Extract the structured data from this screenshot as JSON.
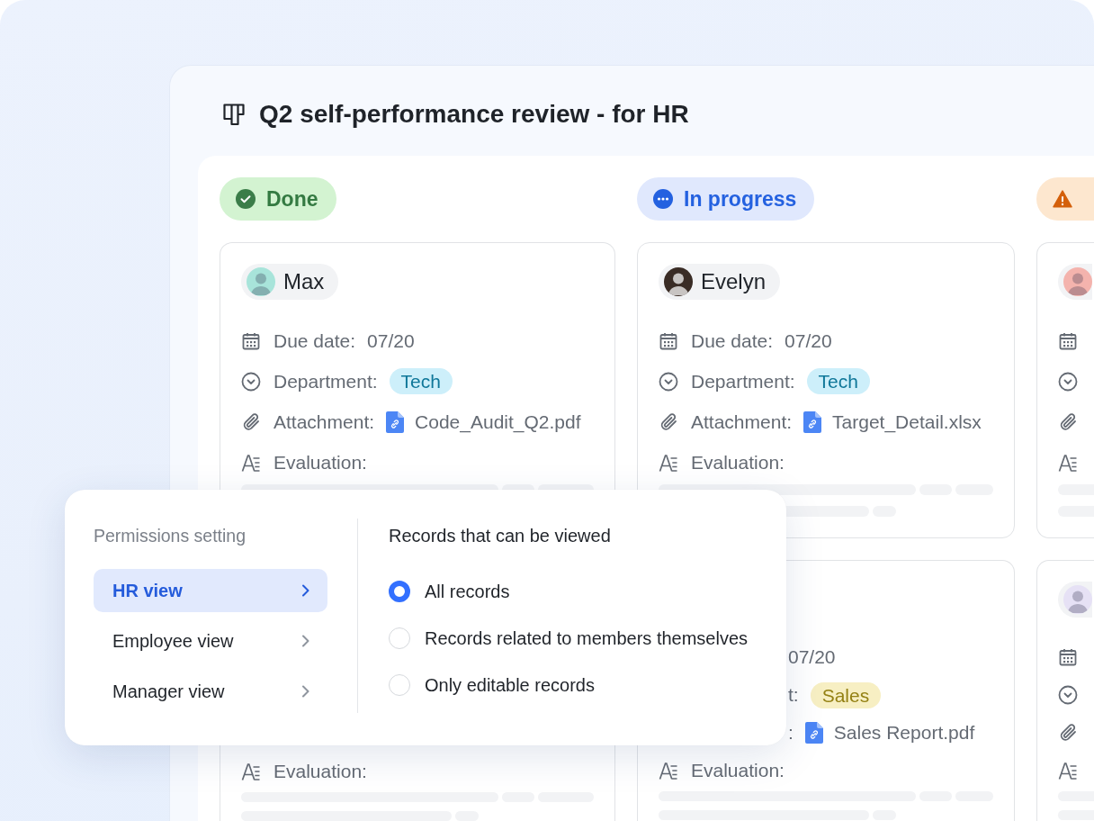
{
  "window": {
    "title": "Q2 self-performance review - for HR"
  },
  "board": {
    "columns": [
      {
        "status": {
          "kind": "done",
          "label": "Done"
        },
        "cards": [
          {
            "name": "Max",
            "color": "#a8e4da",
            "fields": [
              {
                "kind": "due_date",
                "label": "Due date:",
                "value": "07/20"
              },
              {
                "kind": "department",
                "label": "Department:",
                "value": "Tech",
                "color": "#cdeffa"
              },
              {
                "kind": "attachment",
                "label": "Attachment:",
                "value": "Code_Audit_Q2.pdf"
              },
              {
                "kind": "evaluation",
                "label": "Evaluation:"
              }
            ]
          },
          {
            "fields": [
              {
                "kind": "evaluation",
                "label": "Evaluation:"
              }
            ]
          }
        ]
      },
      {
        "status": {
          "kind": "in_progress",
          "label": "In progress"
        },
        "cards": [
          {
            "name": "Evelyn",
            "color": "#3a2c25",
            "fields": [
              {
                "kind": "due_date",
                "label": "Due date:",
                "value": "07/20"
              },
              {
                "kind": "department",
                "label": "Department:",
                "value": "Tech",
                "color": "#cdeffa"
              },
              {
                "kind": "attachment",
                "label": "Attachment:",
                "value": "Target_Detail.xlsx"
              },
              {
                "kind": "evaluation",
                "label": "Evaluation:"
              }
            ]
          },
          {
            "covered_fields": [
              {
                "kind": "due_date",
                "value": "07/20"
              },
              {
                "kind": "department",
                "label": "t:",
                "value": "Sales",
                "color": "#f7efc3"
              },
              {
                "kind": "attachment",
                "label": ":",
                "value": "Sales Report.pdf"
              }
            ],
            "fields": [
              {
                "kind": "evaluation",
                "label": "Evaluation:"
              }
            ]
          }
        ]
      },
      {
        "status": {
          "kind": "warning"
        },
        "cards": [
          {
            "color": "#f4b3ad",
            "fields": [
              {
                "kind": "due_date"
              },
              {
                "kind": "department"
              },
              {
                "kind": "attachment"
              },
              {
                "kind": "evaluation"
              }
            ]
          },
          {
            "color": "#e6e1f5",
            "fields": [
              {
                "kind": "due_date"
              },
              {
                "kind": "department"
              },
              {
                "kind": "attachment"
              },
              {
                "kind": "evaluation"
              }
            ]
          }
        ]
      }
    ]
  },
  "permissions": {
    "heading": "Permissions setting",
    "views": [
      {
        "label": "HR view",
        "selected": true
      },
      {
        "label": "Employee view",
        "selected": false
      },
      {
        "label": "Manager view",
        "selected": false
      }
    ]
  },
  "records": {
    "heading": "Records that can be viewed",
    "options": [
      {
        "label": "All records",
        "selected": true
      },
      {
        "label": "Records related to members themselves",
        "selected": false
      },
      {
        "label": "Only editable records",
        "selected": false
      }
    ]
  }
}
